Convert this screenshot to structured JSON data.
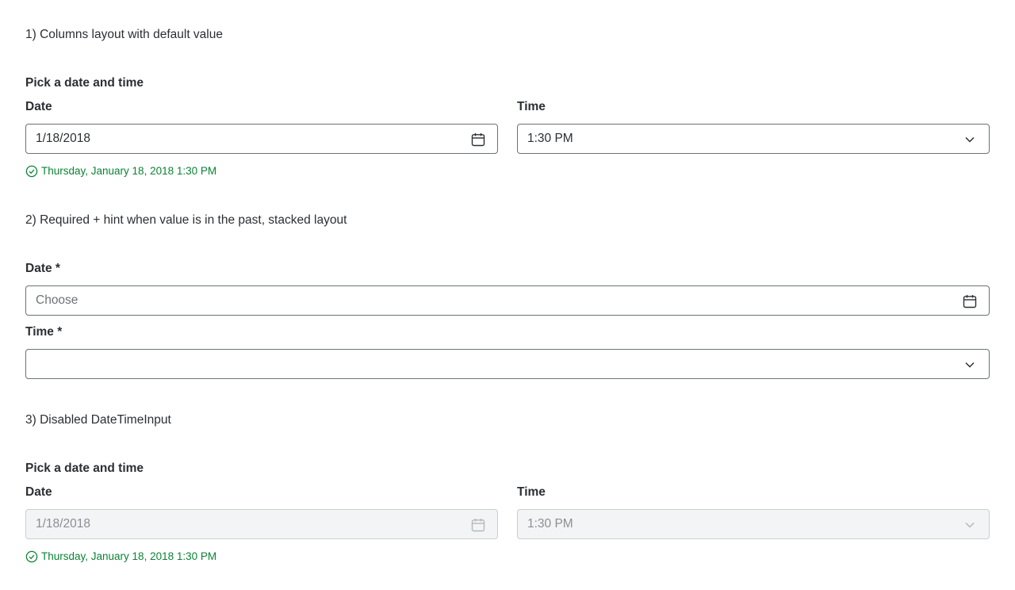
{
  "sections": [
    {
      "title": "1) Columns layout with default value",
      "legend": "Pick a date and time",
      "date_label": "Date",
      "date_value": "1/18/2018",
      "time_label": "Time",
      "time_value": "1:30 PM",
      "message": "Thursday, January 18, 2018 1:30 PM"
    },
    {
      "title": "2) Required + hint when value is in the past, stacked layout",
      "date_label": "Date *",
      "date_placeholder": "Choose",
      "time_label": "Time *",
      "time_value": ""
    },
    {
      "title": "3) Disabled DateTimeInput",
      "legend": "Pick a date and time",
      "date_label": "Date",
      "date_value": "1/18/2018",
      "time_label": "Time",
      "time_value": "1:30 PM",
      "message": "Thursday, January 18, 2018 1:30 PM"
    }
  ],
  "icons": {
    "calendar": "calendar-icon",
    "chevron": "chevron-down-icon",
    "check": "check-circle-icon"
  },
  "colors": {
    "text": "#2b2f33",
    "border": "#6a7278",
    "success": "#0b8235",
    "disabled_bg": "#f3f4f5",
    "disabled_text": "#8a9096"
  }
}
